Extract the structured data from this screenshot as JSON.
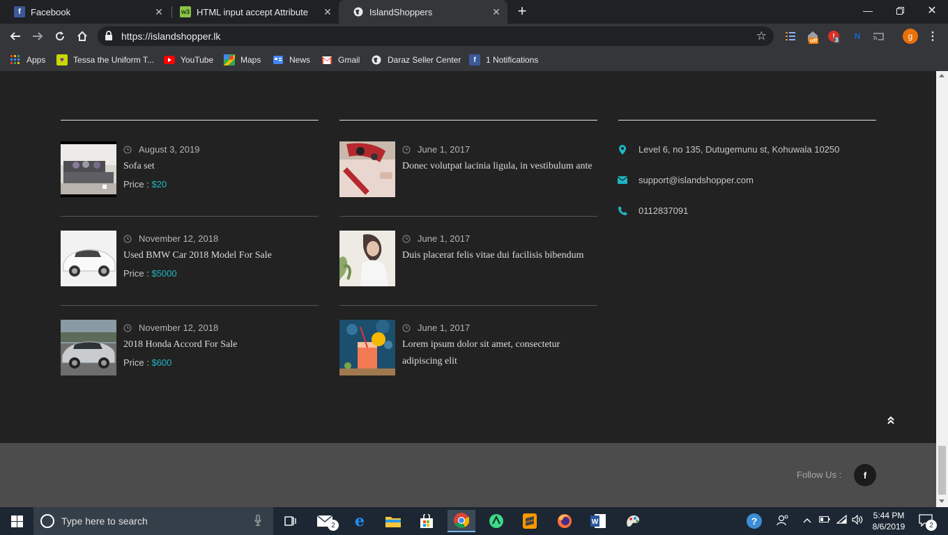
{
  "browser": {
    "tabs": [
      {
        "title": "Facebook",
        "icon": "facebook-icon",
        "active": false
      },
      {
        "title": "HTML input accept Attribute",
        "icon": "w3schools-icon",
        "active": false
      },
      {
        "title": "IslandShoppers",
        "icon": "globe-icon",
        "active": true
      }
    ],
    "url": "https://islandshopper.lk",
    "extension_badges": {
      "coupon": "off",
      "notifications": "3"
    },
    "profile_initial": "g"
  },
  "bookmarks": [
    {
      "label": "Apps",
      "icon": "apps-grid-icon"
    },
    {
      "label": "Tessa the Uniform T...",
      "icon": "heart-icon"
    },
    {
      "label": "YouTube",
      "icon": "youtube-icon"
    },
    {
      "label": "Maps",
      "icon": "maps-icon"
    },
    {
      "label": "News",
      "icon": "news-icon"
    },
    {
      "label": "Gmail",
      "icon": "gmail-icon"
    },
    {
      "label": "Daraz Seller Center",
      "icon": "globe-icon"
    },
    {
      "label": "1 Notifications",
      "icon": "facebook-icon"
    }
  ],
  "products": [
    {
      "date": "August 3, 2019",
      "title": "Sofa set",
      "price_label": "Price :",
      "price": "$20"
    },
    {
      "date": "November 12, 2018",
      "title": "Used BMW Car 2018 Model For Sale",
      "price_label": "Price :",
      "price": "$5000"
    },
    {
      "date": "November 12, 2018",
      "title": "2018 Honda Accord For Sale",
      "price_label": "Price :",
      "price": "$600"
    }
  ],
  "posts": [
    {
      "date": "June 1, 2017",
      "title": "Donec volutpat lacinia ligula, in vestibulum ante"
    },
    {
      "date": "June 1, 2017",
      "title": "Duis placerat felis vitae dui facilisis bibendum"
    },
    {
      "date": "June 1, 2017",
      "title_line1": "Lorem ipsum dolor sit amet, consectetur",
      "title_line2": "adipiscing elit"
    }
  ],
  "contact": {
    "address": "Level 6, no 135, Dutugemunu st, Kohuwala 10250",
    "email": "support@islandshopper.com",
    "phone": "0112837091"
  },
  "footer": {
    "follow_label": "Follow Us :",
    "social": "f"
  },
  "colors": {
    "accent": "#1fb5c2",
    "page_bg": "#222222",
    "footer_bg": "#4c4c4c"
  },
  "taskbar": {
    "search_placeholder": "Type here to search",
    "mail_badge": "2",
    "time": "5:44 PM",
    "date": "8/6/2019",
    "notification_count": "2"
  }
}
